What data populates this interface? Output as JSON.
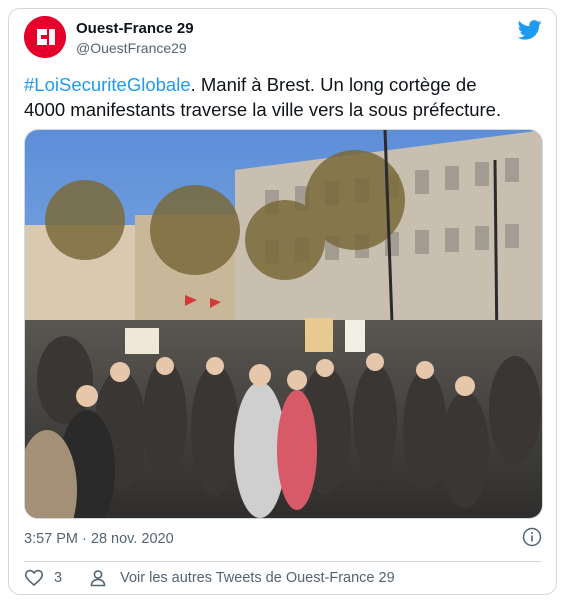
{
  "author": {
    "name": "Ouest-France 29",
    "handle": "@OuestFrance29"
  },
  "tweet": {
    "hashtag": "#LoiSecuriteGlobale",
    "text_after_hashtag": ". Manif à Brest.  Un long cortège de",
    "text_line2": "4000 manifestants traverse la ville vers la sous préfecture."
  },
  "photo": {
    "signs": [
      "",
      "",
      ""
    ]
  },
  "meta": {
    "timestamp": "3:57 PM · 28 nov. 2020"
  },
  "actions": {
    "like_count": "3",
    "more_tweets_label": "Voir les autres Tweets de Ouest-France 29"
  },
  "icons": {
    "brand": "twitter-bird-icon",
    "info": "info-icon",
    "like": "heart-icon",
    "profile": "person-icon"
  },
  "colors": {
    "brand_blue": "#1d9bf0",
    "avatar_red": "#e4002b",
    "muted_text": "#536471",
    "border": "#cfd9de"
  }
}
